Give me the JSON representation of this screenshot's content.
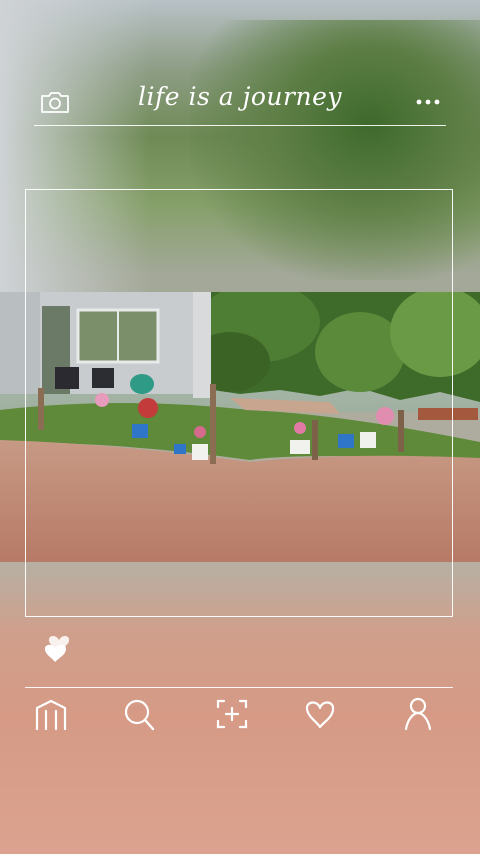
{
  "header": {
    "title": "life is a journey",
    "camera_icon": "camera-icon",
    "more_icon": "more-icon"
  },
  "photo": {
    "description_icon": "photo-image"
  },
  "actions": {
    "like_icon": "heart-icon"
  },
  "nav": {
    "items": [
      {
        "icon": "home-icon"
      },
      {
        "icon": "search-icon"
      },
      {
        "icon": "add-post-icon"
      },
      {
        "icon": "heart-icon"
      },
      {
        "icon": "profile-icon"
      }
    ]
  },
  "colors": {
    "line": "#ffffff",
    "icon": "#ffffff"
  }
}
